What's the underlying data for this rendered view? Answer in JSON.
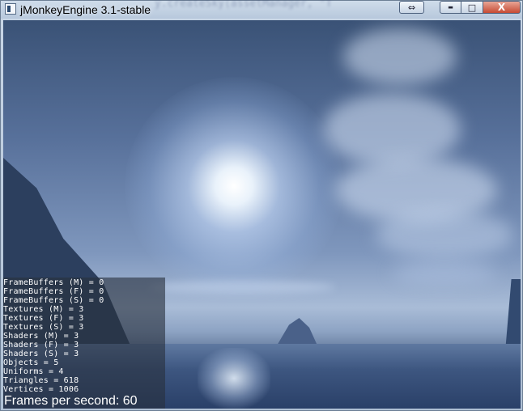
{
  "window": {
    "title": "jMonkeyEngine 3.1-stable",
    "background_code_ghost": "y.createSky(assetManager, \"T",
    "buttons": {
      "resize_glyph": "⇔",
      "minimize_glyph": "▬",
      "maximize_glyph": "□",
      "close_glyph": "X"
    }
  },
  "stats": {
    "lines": [
      "FrameBuffers (M) = 0",
      "FrameBuffers (F) = 0",
      "FrameBuffers (S) = 0",
      "Textures (M) = 3",
      "Textures (F) = 3",
      "Textures (S) = 3",
      "Shaders (M) = 3",
      "Shaders (F) = 3",
      "Shaders (S) = 3",
      "Objects = 5",
      "Uniforms = 4",
      "Triangles = 618",
      "Vertices = 1006"
    ],
    "fps_label": "Frames per second: 60"
  },
  "icons": {
    "app": "java-window-icon",
    "resize": "resize-arrows-icon",
    "minimize": "minimize-icon",
    "maximize": "maximize-icon",
    "close": "close-icon"
  },
  "colors": {
    "sky_top": "#3a5276",
    "sun": "#ffffff",
    "stats_panel": "#28303e"
  }
}
